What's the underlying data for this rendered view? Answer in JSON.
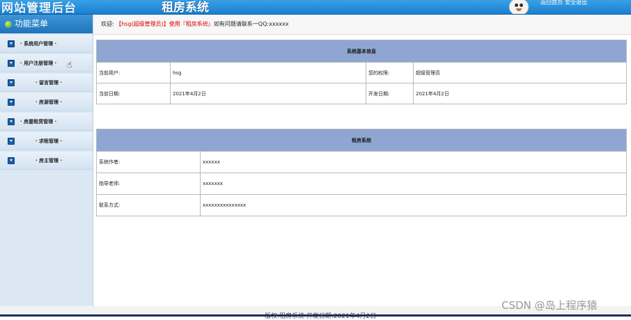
{
  "header": {
    "site_title": "网站管理后台",
    "system_title": "租房系统",
    "links": [
      "返回首页",
      "安全退出"
    ]
  },
  "sidebar": {
    "head_label": "功能菜单",
    "items": [
      {
        "label": "· 系统用户管理 ·"
      },
      {
        "label": "· 用户注册管理 ·"
      },
      {
        "label": "· 留言管理 ·"
      },
      {
        "label": "· 房源管理 ·"
      },
      {
        "label": "· 房屋租赁管理 ·"
      },
      {
        "label": "· 求租管理 ·"
      },
      {
        "label": "· 房主管理 ·"
      }
    ]
  },
  "welcome": {
    "prefix": "欢迎: ",
    "highlight": "【hsg(超级管理员)】使用『租房系统』",
    "suffix": "如有问题请联系一QQ:xxxxxx"
  },
  "system_info": {
    "title": "系统基本信息",
    "current_user_label": "当前用户:",
    "current_user_value": "hsg",
    "permission_label": "您的权限:",
    "permission_value": "超级管理员",
    "current_date_label": "当前日期:",
    "current_date_value": "2021年4月2日",
    "dev_date_label": "开发日期:",
    "dev_date_value": "2021年4月2日"
  },
  "rental_info": {
    "title": "租房系统",
    "rows": [
      {
        "label": "系统作者:",
        "value": "xxxxxx"
      },
      {
        "label": "指导老师:",
        "value": "xxxxxxx"
      },
      {
        "label": "联系方式:",
        "value": "xxxxxxxxxxxxxxx"
      }
    ]
  },
  "footer": {
    "text": "版权:租房系统 开发日期:2021年4月2日"
  },
  "watermark": "CSDN @岛上程序猿",
  "colors": {
    "header": "#1a7fd0",
    "sidebar_bg": "#dbe8f4",
    "table_head": "#8fa6d2",
    "highlight_text": "#dd0000"
  }
}
